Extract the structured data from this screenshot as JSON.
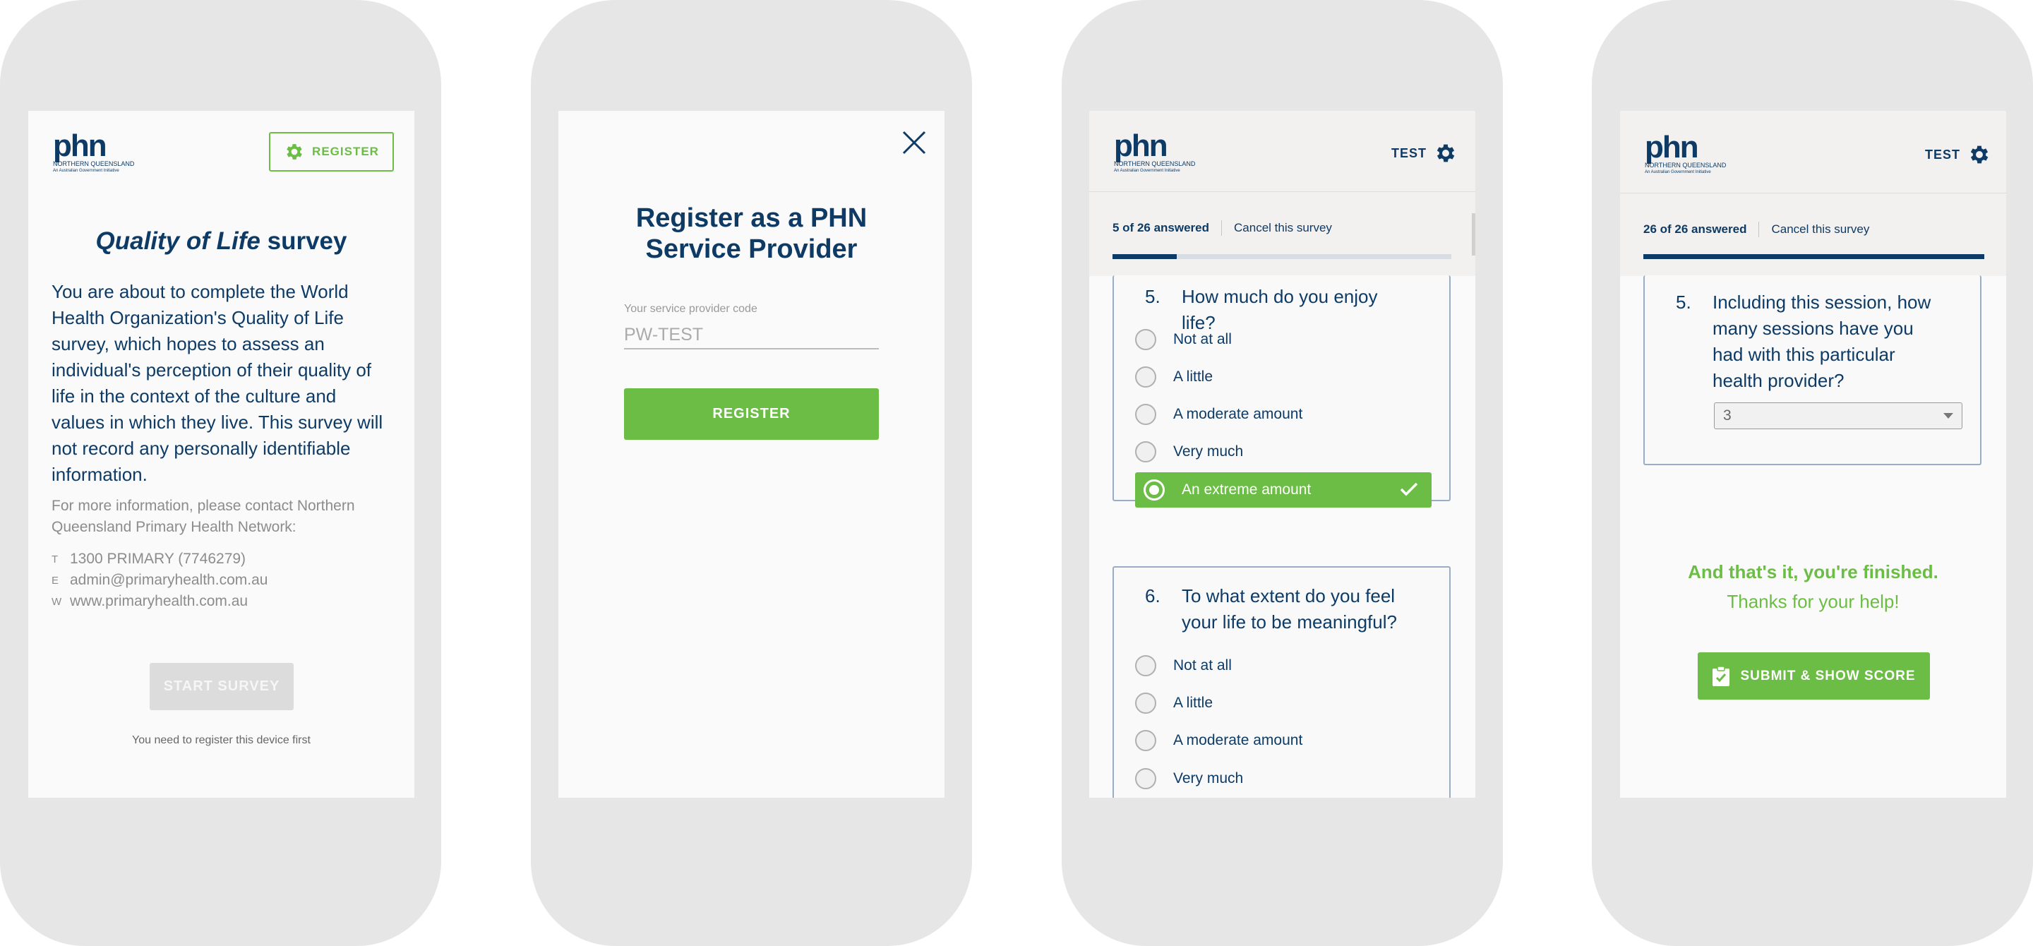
{
  "logo": {
    "brand": "phn",
    "region": "NORTHERN QUEENSLAND",
    "tagline": "An Australian Government Initiative"
  },
  "screen1": {
    "register_label": "REGISTER",
    "title_italic": "Quality of Life",
    "title_rest": " survey",
    "body": "You are about to complete the World Health Organization's Quality of Life survey, which hopes to assess an individual's perception of their quality of life in the context of the culture and values in which they live. This survey will not record any personally identifiable information.",
    "more_info": "For more information, please contact Northern Queensland Primary Health Network:",
    "contacts": [
      {
        "key": "T",
        "value": "1300 PRIMARY (7746279)"
      },
      {
        "key": "E",
        "value": "admin@primaryhealth.com.au"
      },
      {
        "key": "W",
        "value": "www.primaryhealth.com.au"
      }
    ],
    "start_label": "START SURVEY",
    "note": "You need to register this device first"
  },
  "screen2": {
    "title": "Register as a PHN Service Provider",
    "field_label": "Your service provider code",
    "field_value": "PW-TEST",
    "button_label": "REGISTER"
  },
  "screen3": {
    "test_label": "TEST",
    "answered": "5 of 26 answered",
    "cancel": "Cancel this survey",
    "progress": 0.19,
    "q5": {
      "num": "5.",
      "text": "How much do you enjoy life?",
      "options": [
        "Not at all",
        "A little",
        "A moderate amount",
        "Very much",
        "An extreme amount"
      ],
      "selected": "An extreme amount"
    },
    "q6": {
      "num": "6.",
      "text": "To what extent do you feel your life to be meaningful?",
      "options": [
        "Not at all",
        "A little",
        "A moderate amount",
        "Very much"
      ]
    }
  },
  "screen4": {
    "test_label": "TEST",
    "answered": "26 of 26 answered",
    "cancel": "Cancel this survey",
    "progress": 1.0,
    "q5": {
      "num": "5.",
      "text": "Including this session, how many sessions have you had with this particular health provider?",
      "value": "3"
    },
    "finished": "And that's it, you're finished.",
    "thanks": "Thanks for your help!",
    "submit_label": "SUBMIT & SHOW SCORE"
  },
  "colors": {
    "navy": "#0d3b66",
    "green": "#6cbd45",
    "phone_frame": "#e6e6e6"
  }
}
